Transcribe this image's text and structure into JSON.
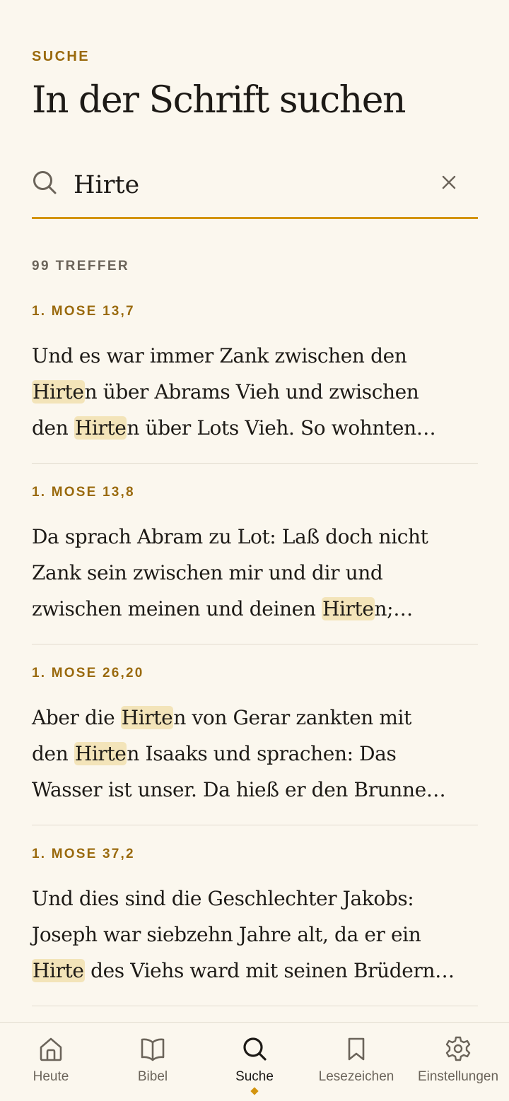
{
  "header": {
    "eyebrow": "SUCHE",
    "title": "In der Schrift suchen"
  },
  "search": {
    "value": "Hirte",
    "icon": "search-icon",
    "clear_icon": "close-icon"
  },
  "results": {
    "count_label": "99 TREFFER",
    "items": [
      {
        "ref": "1. MOSE 13,7",
        "lines": [
          [
            {
              "t": "Und es war immer Zank zwischen den"
            }
          ],
          [
            {
              "t": "Hirte",
              "hl": true
            },
            {
              "t": "n über Abrams Vieh und zwischen"
            }
          ],
          [
            {
              "t": "den "
            },
            {
              "t": "Hirte",
              "hl": true
            },
            {
              "t": "n über Lots Vieh. So wohnten…"
            }
          ]
        ]
      },
      {
        "ref": "1. MOSE 13,8",
        "lines": [
          [
            {
              "t": "Da sprach Abram zu Lot: Laß doch nicht"
            }
          ],
          [
            {
              "t": "Zank sein zwischen mir und dir und"
            }
          ],
          [
            {
              "t": "zwischen meinen und deinen "
            },
            {
              "t": "Hirte",
              "hl": true
            },
            {
              "t": "n;…"
            }
          ]
        ]
      },
      {
        "ref": "1. MOSE 26,20",
        "lines": [
          [
            {
              "t": "Aber die "
            },
            {
              "t": "Hirte",
              "hl": true
            },
            {
              "t": "n von Gerar zankten mit"
            }
          ],
          [
            {
              "t": "den "
            },
            {
              "t": "Hirte",
              "hl": true
            },
            {
              "t": "n Isaaks und sprachen: Das"
            }
          ],
          [
            {
              "t": "Wasser ist unser. Da hieß er den Brunne…"
            }
          ]
        ]
      },
      {
        "ref": "1. MOSE 37,2",
        "lines": [
          [
            {
              "t": "Und dies sind die Geschlechter Jakobs:"
            }
          ],
          [
            {
              "t": "Joseph war siebzehn Jahre alt, da er ein"
            }
          ],
          [
            {
              "t": "Hirte",
              "hl": true
            },
            {
              "t": " des Viehs ward mit seinen Brüdern…"
            }
          ]
        ]
      }
    ]
  },
  "nav": {
    "items": [
      {
        "label": "Heute",
        "icon": "home-icon"
      },
      {
        "label": "Bibel",
        "icon": "open-book-icon"
      },
      {
        "label": "Suche",
        "icon": "search-icon",
        "active": true
      },
      {
        "label": "Lesezeichen",
        "icon": "bookmark-icon"
      },
      {
        "label": "Einstellungen",
        "icon": "gear-icon"
      }
    ]
  },
  "colors": {
    "background": "#fbf7ee",
    "accent": "#d3940f",
    "accent_text": "#9a6a0e",
    "highlight": "#f3e4b9",
    "muted": "#6b645a"
  }
}
